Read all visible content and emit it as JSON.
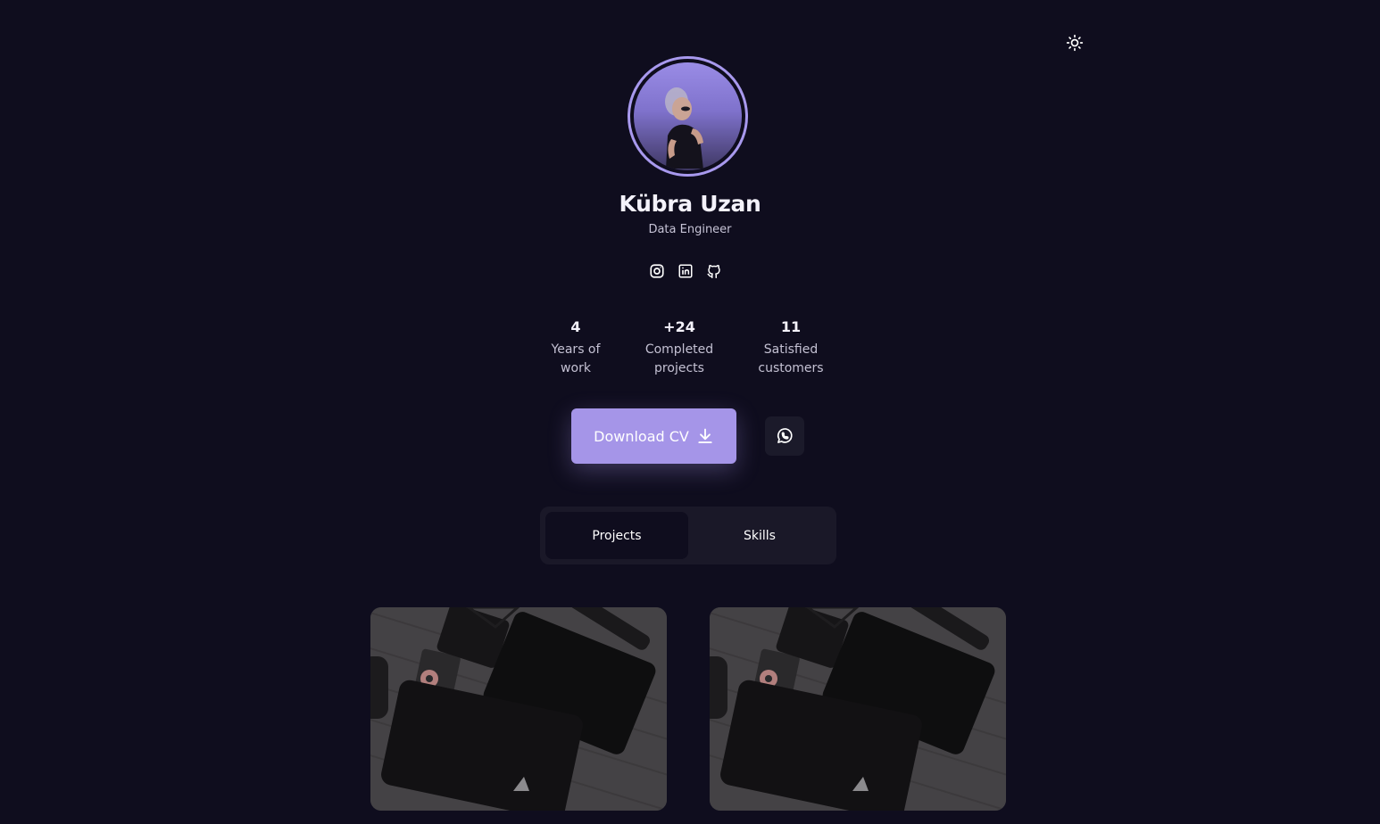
{
  "profile": {
    "name": "Kübra Uzan",
    "role": "Data Engineer"
  },
  "icons": {
    "theme": "sun-icon",
    "socials": [
      "instagram-icon",
      "linkedin-icon",
      "github-icon"
    ],
    "download": "download-icon",
    "contact": "whatsapp-icon"
  },
  "stats": [
    {
      "value": "4",
      "label_line1": "Years of",
      "label_line2": "work"
    },
    {
      "value": "+24",
      "label_line1": "Completed",
      "label_line2": "projects"
    },
    {
      "value": "11",
      "label_line1": "Satisfied",
      "label_line2": "customers"
    }
  ],
  "actions": {
    "download_label": "Download CV"
  },
  "tabs": [
    {
      "label": "Projects",
      "active": true
    },
    {
      "label": "Skills",
      "active": false
    }
  ],
  "colors": {
    "background": "#0f0d1e",
    "accent": "#a595e8",
    "panel": "#1a1828"
  }
}
